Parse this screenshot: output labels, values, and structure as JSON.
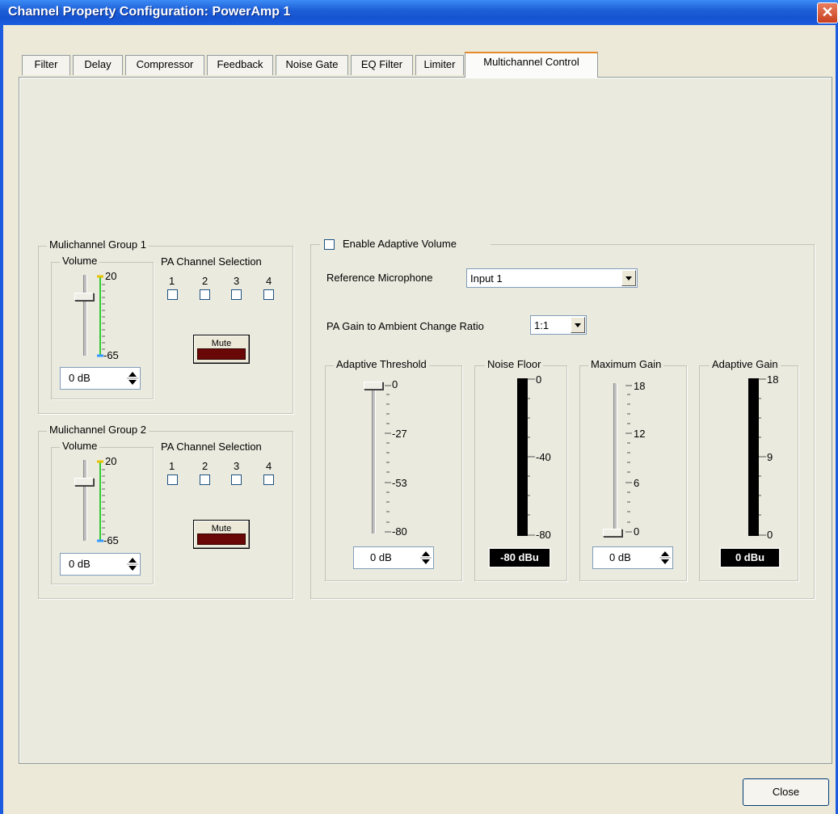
{
  "window": {
    "title": "Channel Property Configuration: PowerAmp 1"
  },
  "tabs": [
    {
      "label": "Filter"
    },
    {
      "label": "Delay"
    },
    {
      "label": "Compressor"
    },
    {
      "label": "Feedback"
    },
    {
      "label": "Noise Gate"
    },
    {
      "label": "EQ Filter"
    },
    {
      "label": "Limiter"
    },
    {
      "label": "Multichannel Control",
      "active": true
    }
  ],
  "group1": {
    "title": "Mulichannel Group 1",
    "volume_label": "Volume",
    "scale_top": "20",
    "scale_bottom": "-65",
    "volume_value": "0 dB",
    "pa_label": "PA Channel Selection",
    "channels": [
      "1",
      "2",
      "3",
      "4"
    ],
    "mute_label": "Mute"
  },
  "group2": {
    "title": "Mulichannel Group 2",
    "volume_label": "Volume",
    "scale_top": "20",
    "scale_bottom": "-65",
    "volume_value": "0 dB",
    "pa_label": "PA Channel Selection",
    "channels": [
      "1",
      "2",
      "3",
      "4"
    ],
    "mute_label": "Mute"
  },
  "adaptive": {
    "enable_label": "Enable Adaptive Volume",
    "ref_mic_label": "Reference Microphone",
    "ref_mic_value": "Input 1",
    "ratio_label": "PA Gain to Ambient Change Ratio",
    "ratio_value": "1:1",
    "threshold": {
      "title": "Adaptive Threshold",
      "scale": [
        "0",
        "-27",
        "-53",
        "-80"
      ],
      "value": "0 dB"
    },
    "noise_floor": {
      "title": "Noise Floor",
      "scale": [
        "0",
        "-40",
        "-80"
      ],
      "value": "-80 dBu"
    },
    "max_gain": {
      "title": "Maximum Gain",
      "scale": [
        "18",
        "12",
        "6",
        "0"
      ],
      "value": "0 dB"
    },
    "adaptive_gain": {
      "title": "Adaptive Gain",
      "scale": [
        "18",
        "9",
        "0"
      ],
      "value": "0 dBu"
    }
  },
  "footer": {
    "close_label": "Close"
  },
  "colors": {
    "titlebar": "#1554d0",
    "mute_indicator": "#6a0808",
    "meter_bg": "#000000",
    "volume_level_bar": "#33cc33"
  }
}
